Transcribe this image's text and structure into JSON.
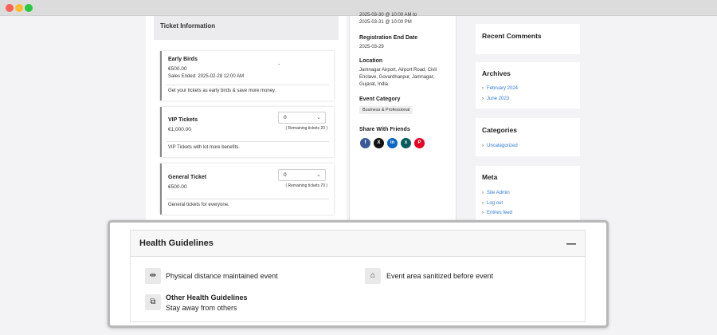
{
  "tickets": {
    "header": "Ticket Information",
    "items": [
      {
        "name": "Early Birds",
        "price": "€500.00",
        "extra": "Sales Ended: 2025-02-28 12:00 AM",
        "qty_display": "-",
        "desc": "Get your tickets as early birds & save more money."
      },
      {
        "name": "VIP Tickets",
        "price": "€1,000.00",
        "qty": "0",
        "remaining": "( Remaining tickets 20 )",
        "desc": "VIP Tickets with lot more benefits."
      },
      {
        "name": "General Ticket",
        "price": "€500.00",
        "qty": "0",
        "remaining": "( Remaining tickets 70 )",
        "desc": "General tickets for everyone."
      }
    ]
  },
  "event": {
    "date_line1": "2025-03-30 @ 10:00 AM to",
    "date_line2": "2025-03-31 @ 10:00 PM",
    "reg_end_label": "Registration End Date",
    "reg_end_value": "2025-03-29",
    "location_label": "Location",
    "location_line1": "Jamnagar Airport, Airport Road, Civil",
    "location_line2": "Enclave, Govardhanpur, Jamnagar,",
    "location_line3": "Gujarat, India",
    "category_label": "Event Category",
    "category_value": "Business & Professional",
    "share_label": "Share With Friends",
    "share": [
      {
        "icon": "facebook-icon",
        "glyph": "f",
        "color": "#3b5998"
      },
      {
        "icon": "x-icon",
        "glyph": "X",
        "color": "#111111"
      },
      {
        "icon": "linkedin-icon",
        "glyph": "in",
        "color": "#0a66c2"
      },
      {
        "icon": "xing-icon",
        "glyph": "x",
        "color": "#0a5d5e"
      },
      {
        "icon": "pinterest-icon",
        "glyph": "P",
        "color": "#e60023"
      }
    ]
  },
  "sidebar": {
    "recent_comments": "Recent Comments",
    "archives": {
      "title": "Archives",
      "items": [
        "February 2024",
        "June 2023"
      ]
    },
    "categories": {
      "title": "Categories",
      "items": [
        "Uncategorized"
      ]
    },
    "meta": {
      "title": "Meta",
      "items": [
        "Site Admin",
        "Log out",
        "Entries feed"
      ]
    }
  },
  "health": {
    "title": "Health Guidelines",
    "collapse_glyph": "—",
    "item1": "Physical distance maintained event",
    "item2": "Event area sanitized before event",
    "other_title": "Other Health Guidelines",
    "other_text": "Stay away from others"
  },
  "colors": {
    "link": "#2f7ad8",
    "badge_bg": "#eeeeee"
  }
}
